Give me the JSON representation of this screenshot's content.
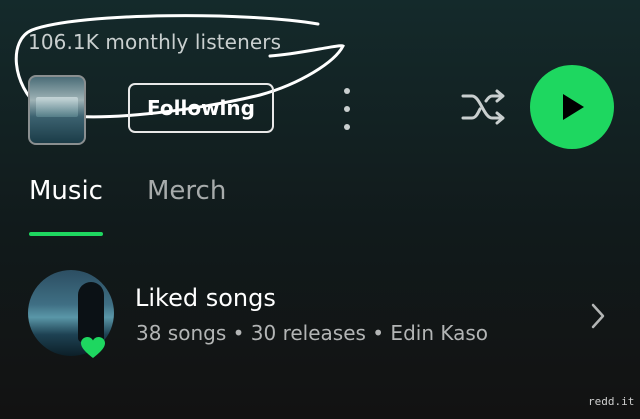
{
  "artist": {
    "monthly_listeners": "106.1K monthly listeners"
  },
  "actions": {
    "following_label": "Following",
    "more_icon": "more-vertical-icon",
    "shuffle_icon": "shuffle-icon",
    "play_icon": "play-icon"
  },
  "tabs": [
    {
      "label": "Music",
      "active": true
    },
    {
      "label": "Merch",
      "active": false
    }
  ],
  "liked": {
    "title": "Liked songs",
    "subtitle": "38 songs • 30 releases • Edin Kaso",
    "badge_icon": "heart-icon"
  },
  "watermark": "redd.it",
  "colors": {
    "accent": "#1ed760",
    "background": "#121212",
    "secondary_text": "#b3b5b5"
  }
}
